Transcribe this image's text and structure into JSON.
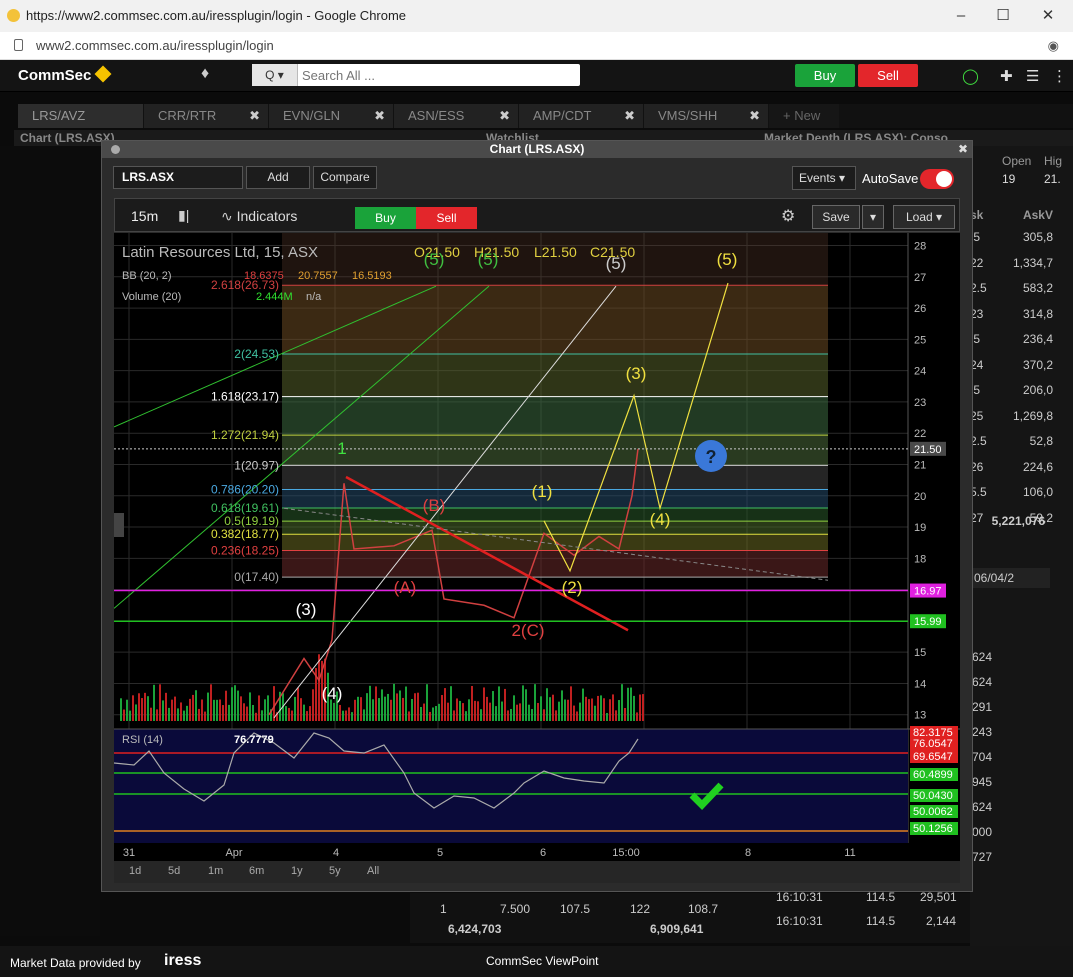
{
  "browser": {
    "title": "https://www2.commsec.com.au/iressplugin/login - Google Chrome",
    "url": "www2.commsec.com.au/iressplugin/login"
  },
  "app": {
    "brand": "CommSec",
    "search_placeholder": "Search All ...",
    "search_scope": "Q ▾",
    "buy_label": "Buy",
    "sell_label": "Sell",
    "tabs": [
      "LRS/AVZ",
      "CRR/RTR",
      "EVN/GLN",
      "ASN/ESS",
      "AMP/CDT",
      "VMS/SHH",
      "+ New"
    ],
    "panel_title": "Chart (LRS.ASX)",
    "watchlist_title": "Watchlist",
    "depth_title": "Market Depth (LRS.ASX): Conso..."
  },
  "chart_window": {
    "title": "Chart (LRS.ASX)",
    "symbol": "LRS.ASX",
    "add_label": "Add",
    "compare_label": "Compare",
    "events_label": "Events ▾",
    "autosave_label": "AutoSave",
    "timeframe": "15m",
    "indicators_label": "Indicators",
    "buy_label": "Buy",
    "sell_label": "Sell",
    "save_label": "Save",
    "load_label": "Load ▾",
    "ranges": [
      "1d",
      "5d",
      "1m",
      "6m",
      "1y",
      "5y",
      "All"
    ]
  },
  "chart_data": {
    "type": "line",
    "title": "Latin Resources Ltd, 15, ASX",
    "ohlc": {
      "o": "O21.50",
      "h": "H21.50",
      "l": "L21.50",
      "c": "C21.50"
    },
    "bb_label": "BB (20, 2)",
    "bb_values": [
      "18.6375",
      "20.7557",
      "16.5193"
    ],
    "volume_label": "Volume (20)",
    "volume_values": [
      "2.444M",
      "n/a"
    ],
    "rsi_label": "RSI (14)",
    "rsi_value": "76.7779",
    "y_ticks": [
      28,
      27,
      26,
      25,
      24,
      23,
      22,
      21,
      20,
      19,
      18,
      17,
      16,
      15,
      14,
      13
    ],
    "ylim": [
      12.8,
      28.4
    ],
    "x_ticks": [
      "31",
      "Apr",
      "4",
      "5",
      "6",
      "15:00",
      "8",
      "11"
    ],
    "last_price": "21.50",
    "price_tags": [
      {
        "text": "16.97",
        "value": 16.97,
        "color": "#e020e0"
      },
      {
        "text": "15.99",
        "value": 15.99,
        "color": "#20c020"
      }
    ],
    "rsi_tags": [
      "82.3175",
      "76.0547",
      "69.6547",
      "60.4899",
      "50.0430",
      "50.0062",
      "50.1256"
    ],
    "fib_levels": [
      {
        "label": "2.618(26.73)",
        "value": 26.73,
        "color": "#d04040"
      },
      {
        "label": "2(24.53)",
        "value": 24.53,
        "color": "#40c0a0"
      },
      {
        "label": "1.618(23.17)",
        "value": 23.17,
        "color": "#ffffff"
      },
      {
        "label": "1.272(21.94)",
        "value": 21.94,
        "color": "#c0d040"
      },
      {
        "label": "1(20.97)",
        "value": 20.97,
        "color": "#cccccc"
      },
      {
        "label": "0.786(20.20)",
        "value": 20.2,
        "color": "#4aa8e0"
      },
      {
        "label": "0.618(19.61)",
        "value": 19.61,
        "color": "#40c060"
      },
      {
        "label": "0.5(19.19)",
        "value": 19.19,
        "color": "#90d040"
      },
      {
        "label": "0.382(18.77)",
        "value": 18.77,
        "color": "#e0e040"
      },
      {
        "label": "0.236(18.25)",
        "value": 18.25,
        "color": "#e04040"
      },
      {
        "label": "0(17.40)",
        "value": 17.4,
        "color": "#aaaaaa"
      }
    ],
    "wave_labels": [
      {
        "text": "(5)",
        "color": "#40c040"
      },
      {
        "text": "(5)",
        "color": "#40c040"
      },
      {
        "text": "(5)",
        "color": "#cccccc"
      },
      {
        "text": "(5)",
        "color": "#f0e040"
      },
      {
        "text": "(3)",
        "color": "#f0e040"
      },
      {
        "text": "1",
        "color": "#40e040"
      },
      {
        "text": "(B)",
        "color": "#e04040"
      },
      {
        "text": "(1)",
        "color": "#f0e040"
      },
      {
        "text": "(4)",
        "color": "#f0e040"
      },
      {
        "text": "(A)",
        "color": "#e04040"
      },
      {
        "text": "(2)",
        "color": "#f0e040"
      },
      {
        "text": "2(C)",
        "color": "#e04040"
      },
      {
        "text": "(3)",
        "color": "#ffffff"
      },
      {
        "text": "(4)",
        "color": "#ffffff"
      }
    ]
  },
  "depth": {
    "open_label": "Open",
    "high_label": "Hig",
    "open_value": "19",
    "high_value": "21.",
    "col_ask": "sk",
    "col_askv": "AskV",
    "rows": [
      [
        ".5",
        "305,8"
      ],
      [
        "22",
        "1,334,7"
      ],
      [
        "2.5",
        "583,2"
      ],
      [
        "23",
        "314,8"
      ],
      [
        ".5",
        "236,4"
      ],
      [
        "24",
        "370,2"
      ],
      [
        ".5",
        "206,0"
      ],
      [
        "25",
        "1,269,8"
      ],
      [
        "2.5",
        "52,8"
      ],
      [
        "26",
        "224,6"
      ],
      [
        "5.5",
        "106,0"
      ],
      [
        "27",
        "59,2"
      ]
    ],
    "total": "5,221,076",
    "date": "06/04/2",
    "vol_rows": [
      "624",
      "624",
      "291",
      "243",
      "704",
      "945",
      "624",
      "000",
      "727"
    ]
  },
  "trades": [
    [
      "1",
      "7.500",
      "107.5",
      "122",
      "108.7"
    ],
    [
      "6,424,703",
      "6,909,641"
    ],
    [
      "16:10:31",
      "114.5",
      "29,501"
    ],
    [
      "16:10:31",
      "114.5",
      "2,144"
    ]
  ],
  "footer": {
    "market_data": "Market Data provided by",
    "iress": "iress",
    "viewpoint": "CommSec ViewPoint"
  }
}
